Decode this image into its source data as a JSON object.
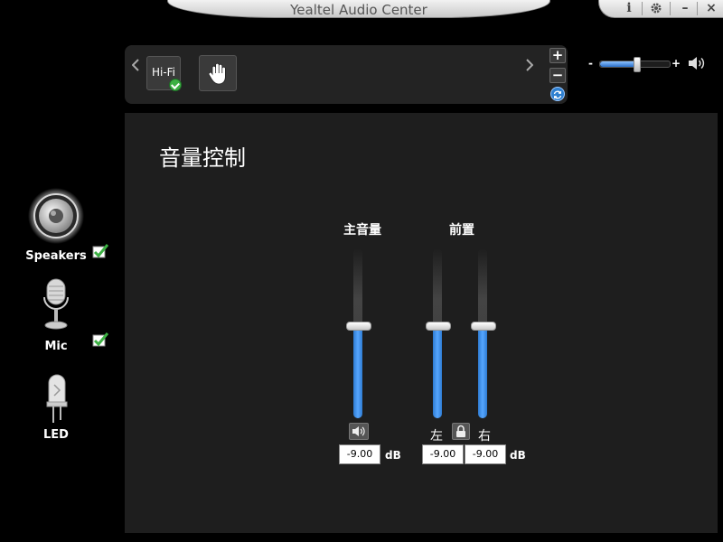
{
  "window": {
    "title": "Yealtel Audio Center",
    "info_icon_label": "i",
    "minimize_label": "–",
    "close_label": "×"
  },
  "presets": {
    "items": [
      {
        "label": "Hi-Fi",
        "icon": "hifi-icon",
        "active": true
      },
      {
        "label": "",
        "icon": "hand-icon",
        "active": false
      }
    ],
    "add_label": "+",
    "remove_label": "−"
  },
  "master_volume": {
    "minus_label": "-",
    "plus_label": "+",
    "level": 0.52
  },
  "sidebar": {
    "items": [
      {
        "label": "Speakers",
        "icon": "speaker-icon",
        "checked": true
      },
      {
        "label": "Mic",
        "icon": "microphone-icon",
        "checked": true
      },
      {
        "label": "LED",
        "icon": "led-icon",
        "checked": false
      }
    ]
  },
  "main": {
    "title": "音量控制",
    "master": {
      "label": "主音量",
      "level": 0.55,
      "db_value": "-9.00",
      "unit": "dB"
    },
    "front": {
      "label": "前置",
      "left_label": "左",
      "right_label": "右",
      "left_level": 0.55,
      "right_level": 0.55,
      "left_db": "-9.00",
      "right_db": "-9.00",
      "unit": "dB"
    }
  },
  "colors": {
    "accent": "#3d8ee8",
    "panel": "#1e1e1e",
    "check": "#3cb043"
  }
}
